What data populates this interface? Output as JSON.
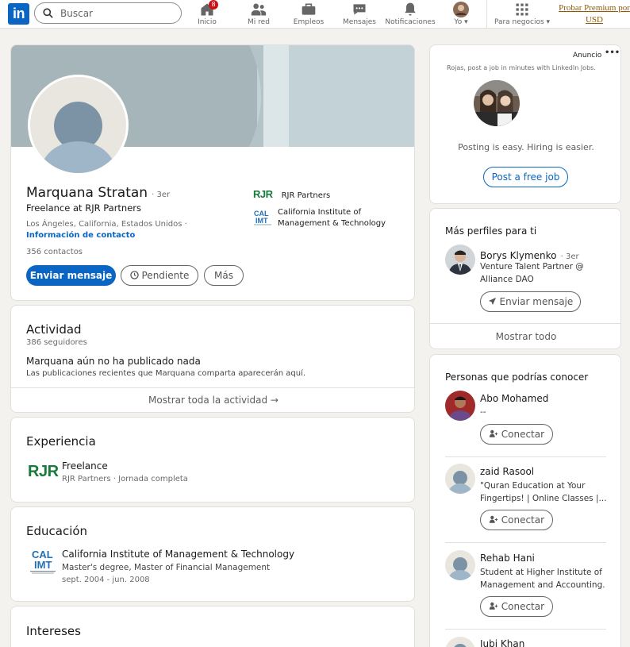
{
  "nav": {
    "logo_text": "in",
    "search_placeholder": "Buscar",
    "items": [
      {
        "label": "Inicio",
        "badge": "8"
      },
      {
        "label": "Mi red"
      },
      {
        "label": "Empleos"
      },
      {
        "label": "Mensajes"
      },
      {
        "label": "Notificaciones"
      },
      {
        "label": "Yo ▾"
      },
      {
        "label": "Para negocios ▾"
      }
    ],
    "premium_line1": "Probar Premium por",
    "premium_line2": "USD"
  },
  "profile": {
    "name": "Marquana Stratan",
    "degree": "· 3er",
    "headline": "Freelance at RJR Partners",
    "location": "Los Ángeles, California, Estados Unidos ·",
    "contact_link": "Información de contacto",
    "connections": "356 contactos",
    "company": "RJR Partners",
    "school_line1": "California Institute of",
    "school_line2": "Management & Technology",
    "buttons": {
      "message": "Enviar mensaje",
      "pending": "Pendiente",
      "more": "Más"
    }
  },
  "activity": {
    "title": "Actividad",
    "followers": "386 seguidores",
    "empty_title": "Marquana aún no ha publicado nada",
    "empty_desc": "Las publicaciones recientes que Marquana comparta aparecerán aquí.",
    "show_all": "Mostrar toda la actividad →"
  },
  "experience": {
    "title": "Experiencia",
    "role": "Freelance",
    "detail": "RJR Partners · Jornada completa"
  },
  "education": {
    "title": "Educación",
    "school": "California Institute of Management & Technology",
    "degree": "Master's degree, Master of Financial Management",
    "dates": "sept. 2004 - jun. 2008"
  },
  "interests": {
    "title": "Intereses"
  },
  "ad": {
    "label": "Anuncio",
    "menu": "•••",
    "text": "Rojas, post a job in minutes with LinkedIn Jobs.",
    "tagline": "Posting is easy. Hiring is easier.",
    "button": "Post a free job"
  },
  "more_profiles": {
    "title": "Más perfiles para ti",
    "person": {
      "name": "Borys Klymenko",
      "degree": "· 3er",
      "headline1": "Venture Talent Partner @",
      "headline2": "Alliance DAO",
      "button": "Enviar mensaje"
    },
    "show_all": "Mostrar todo"
  },
  "pymk": {
    "title": "Personas que podrías conocer",
    "people": [
      {
        "name": "Abo Mohamed",
        "line1": "--",
        "line2": "",
        "button": "Conectar"
      },
      {
        "name": "zaid Rasool",
        "line1": "\"Quran Education at Your",
        "line2": "Fingertips! | Online Classes |...",
        "button": "Conectar"
      },
      {
        "name": "Rehab Hani",
        "line1": "Student at Higher Institute of",
        "line2": "Management and Accounting.",
        "button": "Conectar"
      },
      {
        "name": "Jubi Khan",
        "line1": "",
        "line2": "",
        "button": ""
      }
    ]
  },
  "colors": {
    "brand": "#0a66c2",
    "background": "#f3f2ef",
    "badge": "#cc1016",
    "premium": "#915907"
  }
}
